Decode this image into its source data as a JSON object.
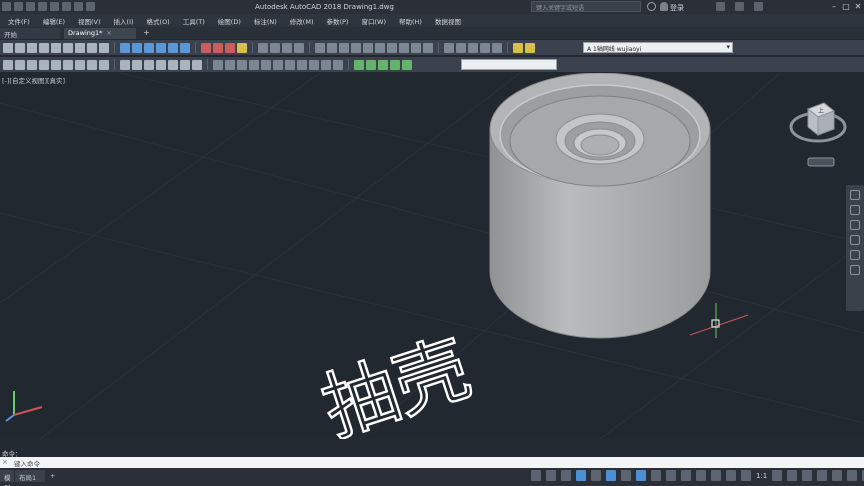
{
  "titlebar": {
    "title": "Autodesk AutoCAD 2018   Drawing1.dwg",
    "search_placeholder": "键入关键字或短语",
    "login_label": "登录"
  },
  "menubar": {
    "items": [
      "文件(F)",
      "编辑(E)",
      "视图(V)",
      "插入(I)",
      "格式(O)",
      "工具(T)",
      "绘图(D)",
      "标注(N)",
      "修改(M)",
      "参数(P)",
      "窗口(W)",
      "帮助(H)",
      "数据视图"
    ]
  },
  "tabs": {
    "items": [
      {
        "label": "开始"
      },
      {
        "label": "Drawing1*"
      }
    ],
    "add_label": "+"
  },
  "layer": {
    "current": "A  1轴网线 wujiaoyi"
  },
  "viewport": {
    "view_label": "[-][自定义视图][真实]",
    "annotation_text": "抽壳",
    "colors": {
      "background": "#212830",
      "grid": "#2c3440",
      "solid": "#a8aaac",
      "annotation": "#ffffff"
    }
  },
  "viewcube": {
    "face_label": "上"
  },
  "command": {
    "history": "命令：",
    "placeholder": "键入命令"
  },
  "layout_tabs": {
    "items": [
      "模型",
      "布局1"
    ],
    "add_label": "+"
  },
  "status": {
    "scale": "1:1"
  }
}
